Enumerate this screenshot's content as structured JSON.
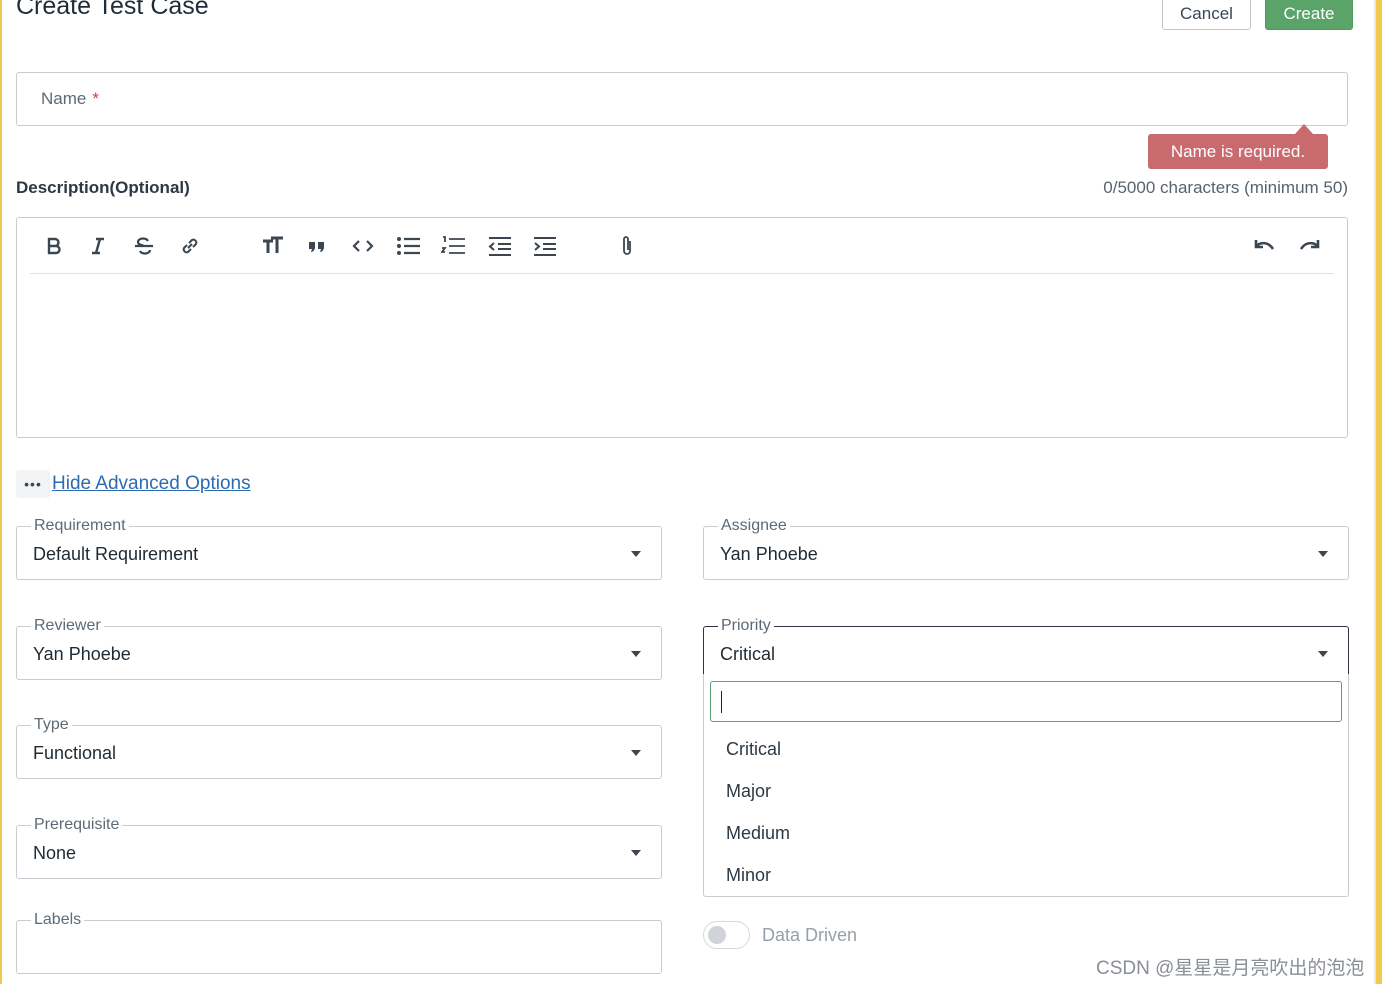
{
  "page": {
    "title": "Create Test Case",
    "cancel_label": "Cancel",
    "create_label": "Create"
  },
  "name_field": {
    "label": "Name",
    "required_mark": "*",
    "error": "Name is required."
  },
  "description": {
    "label": "Description(Optional)",
    "char_count": "0/5000 characters (minimum 50)",
    "toolbar": [
      "bold",
      "italic",
      "strikethrough",
      "link",
      "heading",
      "quote",
      "code",
      "bullet-list",
      "numbered-list",
      "decrease-indent",
      "increase-indent",
      "attachment",
      "undo",
      "redo"
    ]
  },
  "advanced": {
    "dots": "•••",
    "toggle_label": "Hide Advanced Options"
  },
  "fields": {
    "requirement": {
      "label": "Requirement",
      "value": "Default Requirement"
    },
    "assignee": {
      "label": "Assignee",
      "value": "Yan Phoebe"
    },
    "reviewer": {
      "label": "Reviewer",
      "value": "Yan Phoebe"
    },
    "priority": {
      "label": "Priority",
      "value": "Critical"
    },
    "type": {
      "label": "Type",
      "value": "Functional"
    },
    "prerequisite": {
      "label": "Prerequisite",
      "value": "None"
    },
    "labels": {
      "label": "Labels",
      "value": ""
    }
  },
  "priority_dropdown": {
    "search_value": "",
    "options": [
      "Critical",
      "Major",
      "Medium",
      "Minor"
    ]
  },
  "data_driven": {
    "label": "Data Driven",
    "enabled": false
  },
  "watermark": "CSDN @星星是月亮吹出的泡泡",
  "colors": {
    "accent_green": "#5aa469",
    "error_red": "#c96b6e",
    "link_blue": "#2b6cb0",
    "frame_yellow": "#f3c94f"
  }
}
